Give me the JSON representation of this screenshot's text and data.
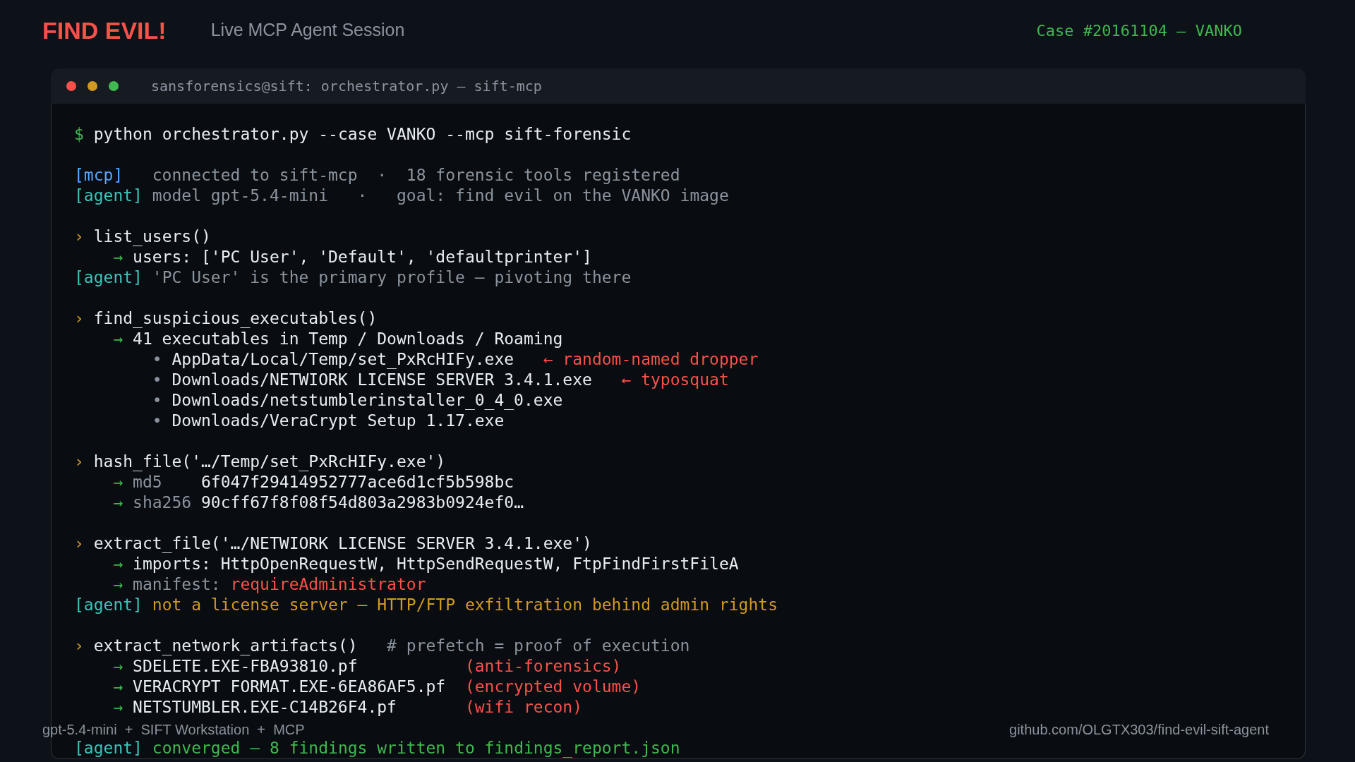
{
  "header": {
    "title": "FIND EVIL!",
    "subtitle": "Live MCP Agent Session",
    "case": "Case #20161104 — VANKO"
  },
  "terminal": {
    "title": "sansforensics@sift: orchestrator.py — sift-mcp",
    "blocks": [
      [
        {
          "kind": "command",
          "marker": "$",
          "text": "python orchestrator.py --case VANKO --mcp sift-forensic"
        }
      ],
      [
        {
          "kind": "mcp",
          "tag": "[mcp]",
          "text": "connected to sift-mcp  ·  18 forensic tools registered",
          "color": "#8b949e"
        },
        {
          "kind": "agent",
          "tag": "[agent]",
          "text": "model gpt-5.4-mini   ·   goal: find evil on the VANKO image",
          "color": "#8b949e"
        }
      ],
      [
        {
          "kind": "call",
          "marker": "›",
          "text": "list_users()"
        },
        {
          "kind": "result",
          "marker": "→",
          "text": "users: ['PC User', 'Default', 'defaultprinter']",
          "color": "#e6edf3"
        },
        {
          "kind": "agent",
          "tag": "[agent]",
          "text": "'PC User' is the primary profile — pivoting there",
          "color": "#8b949e"
        }
      ],
      [
        {
          "kind": "call",
          "marker": "›",
          "text": "find_suspicious_executables()"
        },
        {
          "kind": "result",
          "marker": "→",
          "text": "41 executables in Temp / Downloads / Roaming",
          "color": "#e6edf3"
        },
        {
          "kind": "bullet",
          "marker": "•",
          "text": "AppData/Local/Temp/set_PxRcHIFy.exe",
          "note": "← random-named dropper"
        },
        {
          "kind": "bullet",
          "marker": "•",
          "text": "Downloads/NETWIORK LICENSE SERVER 3.4.1.exe",
          "note": "← typosquat"
        },
        {
          "kind": "bullet",
          "marker": "•",
          "text": "Downloads/netstumblerinstaller_0_4_0.exe"
        },
        {
          "kind": "bullet",
          "marker": "•",
          "text": "Downloads/VeraCrypt Setup 1.17.exe"
        }
      ],
      [
        {
          "kind": "call",
          "marker": "›",
          "text": "hash_file('…/Temp/set_PxRcHIFy.exe')"
        },
        {
          "kind": "result",
          "marker": "→",
          "key": "md5",
          "text": "6f047f29414952777ace6d1cf5b598bc",
          "color": "#e6edf3"
        },
        {
          "kind": "result",
          "marker": "→",
          "key": "sha256",
          "text": "90cff67f8f08f54d803a2983b0924ef0…",
          "color": "#e6edf3"
        }
      ],
      [
        {
          "kind": "call",
          "marker": "›",
          "text": "extract_file('…/NETWIORK LICENSE SERVER 3.4.1.exe')"
        },
        {
          "kind": "result",
          "marker": "→",
          "text": "imports: HttpOpenRequestW, HttpSendRequestW, FtpFindFirstFileA",
          "color": "#e6edf3"
        },
        {
          "kind": "result",
          "marker": "→",
          "key": "manifest:",
          "text": "requireAdministrator",
          "color": "#f85149"
        },
        {
          "kind": "agent",
          "tag": "[agent]",
          "text": "not a license server — HTTP/FTP exfiltration behind admin rights",
          "color": "#d29922"
        }
      ],
      [
        {
          "kind": "call",
          "marker": "›",
          "text": "extract_network_artifacts()",
          "comment": "# prefetch = proof of execution"
        },
        {
          "kind": "artifact",
          "marker": "→",
          "text": "SDELETE.EXE-FBA93810.pf",
          "note": "(anti-forensics)"
        },
        {
          "kind": "artifact",
          "marker": "→",
          "text": "VERACRYPT FORMAT.EXE-6EA86AF5.pf",
          "note": "(encrypted volume)"
        },
        {
          "kind": "artifact",
          "marker": "→",
          "text": "NETSTUMBLER.EXE-C14B26F4.pf",
          "note": "(wifi recon)"
        }
      ],
      [
        {
          "kind": "agent",
          "tag": "[agent]",
          "text": "converged — 8 findings written to findings_report.json",
          "color": "#3fb950"
        }
      ]
    ]
  },
  "footer": {
    "stack": "gpt-5.4-mini  +  SIFT Workstation  +  MCP",
    "repo": "github.com/OLGTX303/find-evil-sift-agent"
  }
}
